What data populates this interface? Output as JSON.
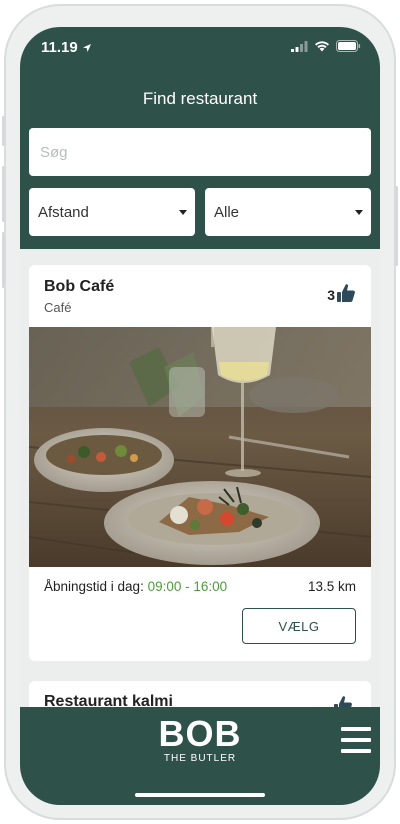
{
  "status_bar": {
    "time": "11.19"
  },
  "header": {
    "title": "Find restaurant",
    "search_placeholder": "Søg",
    "filter_distance": "Afstand",
    "filter_category": "Alle"
  },
  "restaurants": [
    {
      "name": "Bob Café",
      "category": "Café",
      "likes": "3",
      "hours_label": "Åbningstid i dag:",
      "hours_value": "09:00 - 16:00",
      "distance": "13.5 km",
      "action_label": "VÆLG"
    },
    {
      "name": "Restaurant kalmi"
    }
  ],
  "footer": {
    "logo_main": "BOB",
    "logo_sub": "THE BUTLER"
  },
  "colors": {
    "primary": "#2e5149",
    "hours_green": "#4f9a3c"
  },
  "icons": [
    "location-arrow-icon",
    "signal-icon",
    "wifi-icon",
    "battery-icon",
    "thumbs-up-icon",
    "hamburger-menu-icon"
  ]
}
